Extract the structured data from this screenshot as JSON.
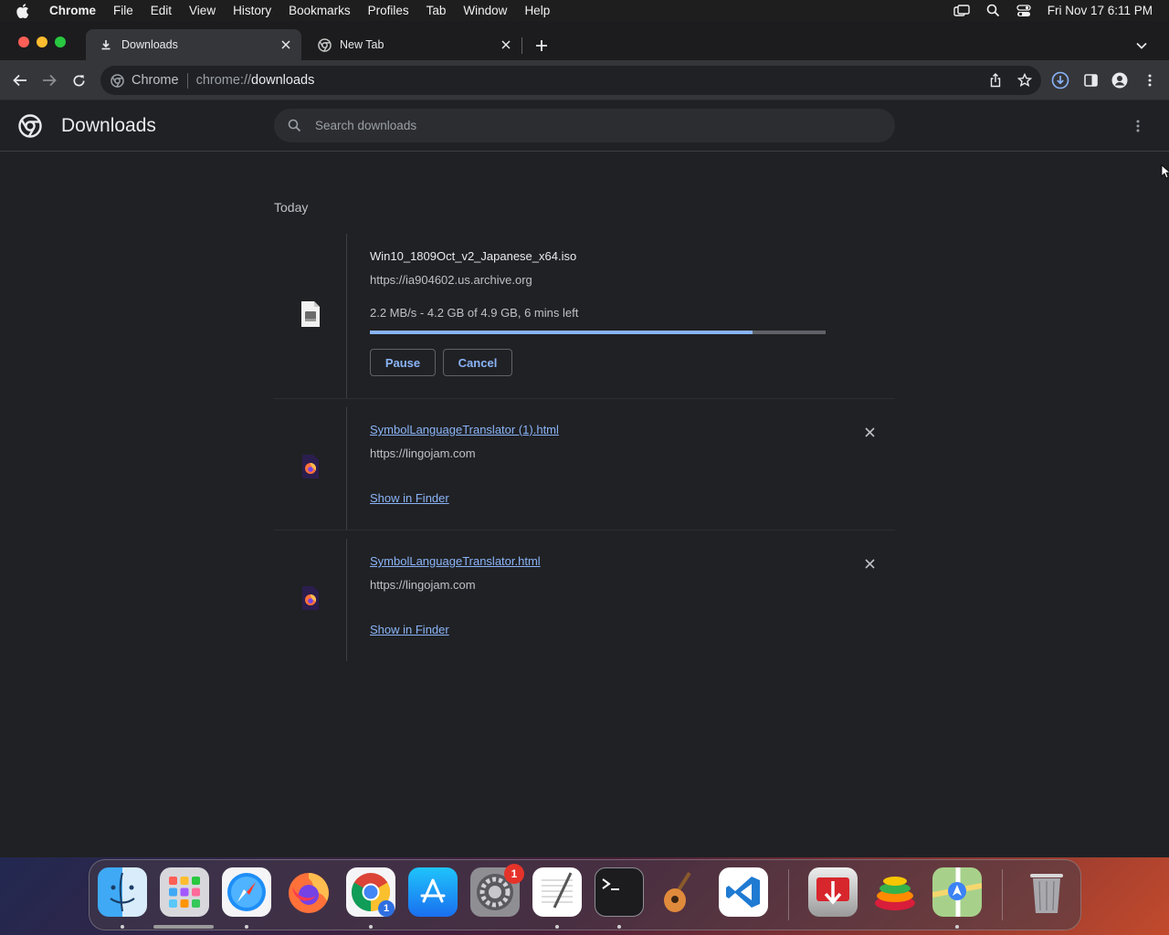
{
  "menubar": {
    "app_name": "Chrome",
    "items": [
      "File",
      "Edit",
      "View",
      "History",
      "Bookmarks",
      "Profiles",
      "Tab",
      "Window",
      "Help"
    ],
    "clock": "Fri Nov 17  6:11 PM"
  },
  "tabs": [
    {
      "label": "Downloads",
      "icon": "download-icon",
      "active": true
    },
    {
      "label": "New Tab",
      "icon": "chrome-icon",
      "active": false
    }
  ],
  "omnibox": {
    "site_name": "Chrome",
    "url_scheme": "chrome://",
    "url_path": "downloads"
  },
  "downloads_page": {
    "title": "Downloads",
    "search_placeholder": "Search downloads",
    "section_label": "Today",
    "items": [
      {
        "file_name": "Win10_1809Oct_v2_Japanese_x64.iso",
        "source_url": "https://ia904602.us.archive.org",
        "status": "2.2 MB/s - 4.2 GB of 4.9 GB, 6 mins left",
        "progress": 0.84,
        "pause_label": "Pause",
        "cancel_label": "Cancel",
        "icon": "iso-file-icon"
      },
      {
        "file_name": "SymbolLanguageTranslator (1).html",
        "source_url": "https://lingojam.com",
        "show_in_finder_label": "Show in Finder",
        "icon": "firefox-html-file-icon"
      },
      {
        "file_name": "SymbolLanguageTranslator.html",
        "source_url": "https://lingojam.com",
        "show_in_finder_label": "Show in Finder",
        "icon": "firefox-html-file-icon"
      }
    ]
  },
  "dock": {
    "apps": [
      "Finder",
      "Launchpad",
      "Safari",
      "Firefox",
      "Google Chrome",
      "App Store",
      "System Settings",
      "TextEdit",
      "Terminal",
      "GarageBand",
      "Visual Studio Code",
      "Transmit",
      "Stack",
      "Maps",
      "Trash"
    ],
    "system_settings_badge": "1",
    "chrome_badge": "1"
  },
  "colors": {
    "accent": "#8ab4f8",
    "page_bg": "#202124",
    "toolbar_bg": "#35363a"
  }
}
